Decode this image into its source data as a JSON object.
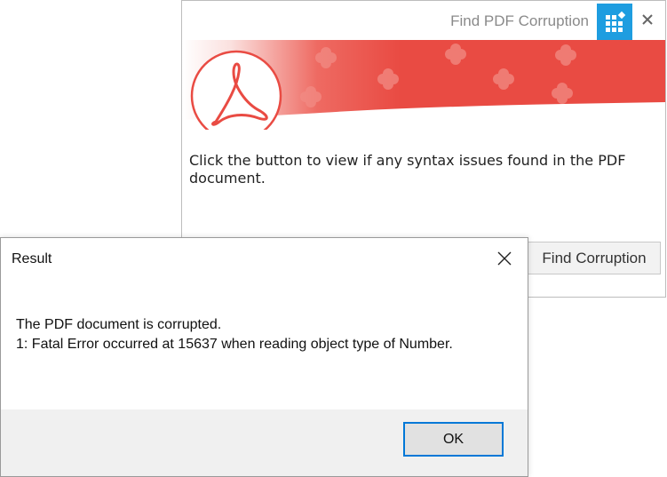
{
  "app": {
    "title": "Find PDF Corruption",
    "instructions": "Click the button to view if any syntax issues found in the PDF document.",
    "find_button": "Find Corruption"
  },
  "dialog": {
    "title": "Result",
    "line1": "The PDF document is corrupted.",
    "line2": "1: Fatal Error occurred at 15637 when reading object type of Number.",
    "ok_button": "OK"
  },
  "colors": {
    "banner_red": "#e94b43",
    "accent_blue": "#1e9de0",
    "focus_blue": "#0078d7"
  },
  "icons": [
    "app-grid-icon",
    "close-icon",
    "pdf-logo-icon",
    "flower-decor-icon"
  ]
}
